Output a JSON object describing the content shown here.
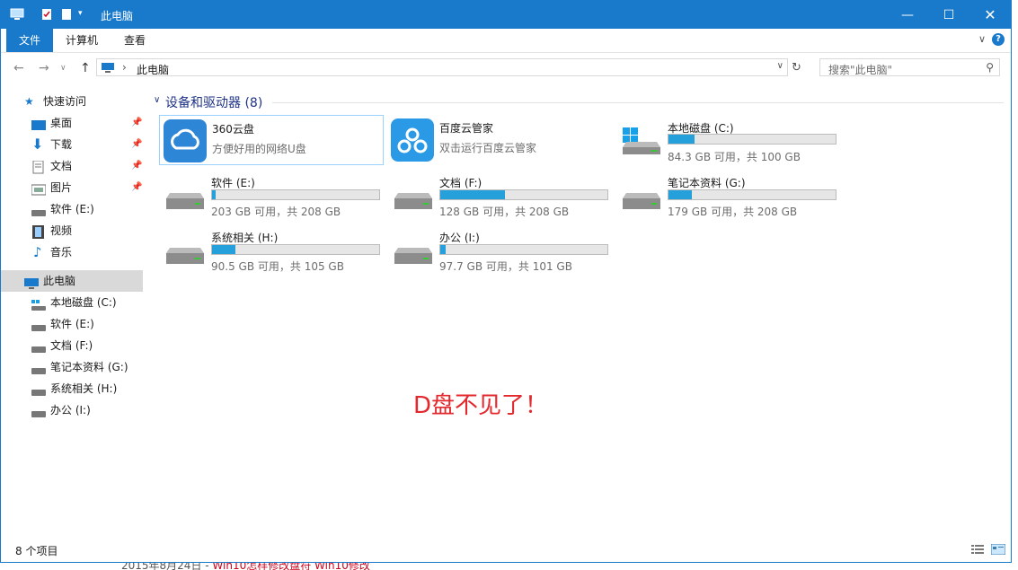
{
  "window": {
    "title": "此电脑"
  },
  "ribbon": {
    "tabs": [
      "文件",
      "计算机",
      "查看"
    ],
    "help": "?"
  },
  "address": {
    "path": "此电脑",
    "separator": "›"
  },
  "search": {
    "placeholder": "搜索\"此电脑\""
  },
  "sidebar": {
    "quick_access": "快速访问",
    "quick_items": [
      "桌面",
      "下载",
      "文档",
      "图片",
      "软件 (E:)",
      "视频",
      "音乐"
    ],
    "this_pc": "此电脑",
    "pc_items": [
      "本地磁盘 (C:)",
      "软件 (E:)",
      "文档 (F:)",
      "笔记本资料 (G:)",
      "系统相关 (H:)",
      "办公 (I:)"
    ]
  },
  "group": {
    "title": "设备和驱动器 (8)"
  },
  "apps": [
    {
      "name": "360云盘",
      "subtitle": "方便好用的网络U盘"
    },
    {
      "name": "百度云管家",
      "subtitle": "双击运行百度云管家"
    }
  ],
  "drives": [
    {
      "name": "本地磁盘 (C:)",
      "free": "84.3 GB 可用，共 100 GB",
      "used_fraction": 0.157
    },
    {
      "name": "软件 (E:)",
      "free": "203 GB 可用，共 208 GB",
      "used_fraction": 0.024
    },
    {
      "name": "文档 (F:)",
      "free": "128 GB 可用，共 208 GB",
      "used_fraction": 0.385
    },
    {
      "name": "笔记本资料 (G:)",
      "free": "179 GB 可用，共 208 GB",
      "used_fraction": 0.139
    },
    {
      "name": "系统相关 (H:)",
      "free": "90.5 GB 可用，共 105 GB",
      "used_fraction": 0.138
    },
    {
      "name": "办公 (I:)",
      "free": "97.7 GB 可用，共 101 GB",
      "used_fraction": 0.033
    }
  ],
  "annotation": "D盘不见了！",
  "status": {
    "count": "8 个项目"
  },
  "background_page": {
    "text_plain": "2015年8月24日 - ",
    "text_red": "Win10怎样修改盘符 Win10修改"
  },
  "colors": {
    "accent": "#1979ca",
    "bar": "#26a0da",
    "note": "#e3292e"
  }
}
